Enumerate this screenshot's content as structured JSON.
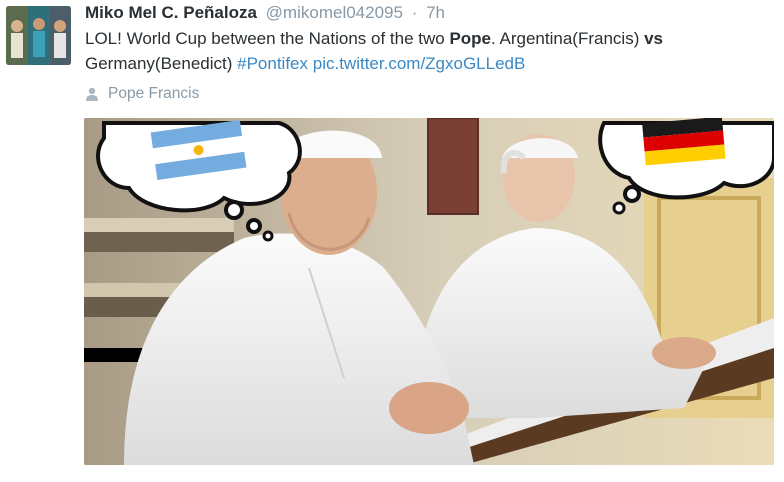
{
  "tweet": {
    "author_name": "Miko Mel C. Peñaloza",
    "handle": "@mikomel042095",
    "separator": "·",
    "time": "7h",
    "text_part1": "LOL! World Cup between the Nations of the two ",
    "text_bold1": "Pope",
    "text_part2": ". Argentina(Francis) ",
    "text_bold2": "vs",
    "text_part3": " Germany(Benedict) ",
    "hashtag": "#Pontifex",
    "media_link": "pic.twitter.com/ZgxoGLLedB",
    "place": "Pope Francis"
  },
  "icons": {
    "place_icon": "person-icon",
    "flag_left": "argentina-flag",
    "flag_right": "germany-flag"
  },
  "colors": {
    "link": "#3b88c3",
    "muted": "#8899a6",
    "text": "#292f33"
  }
}
